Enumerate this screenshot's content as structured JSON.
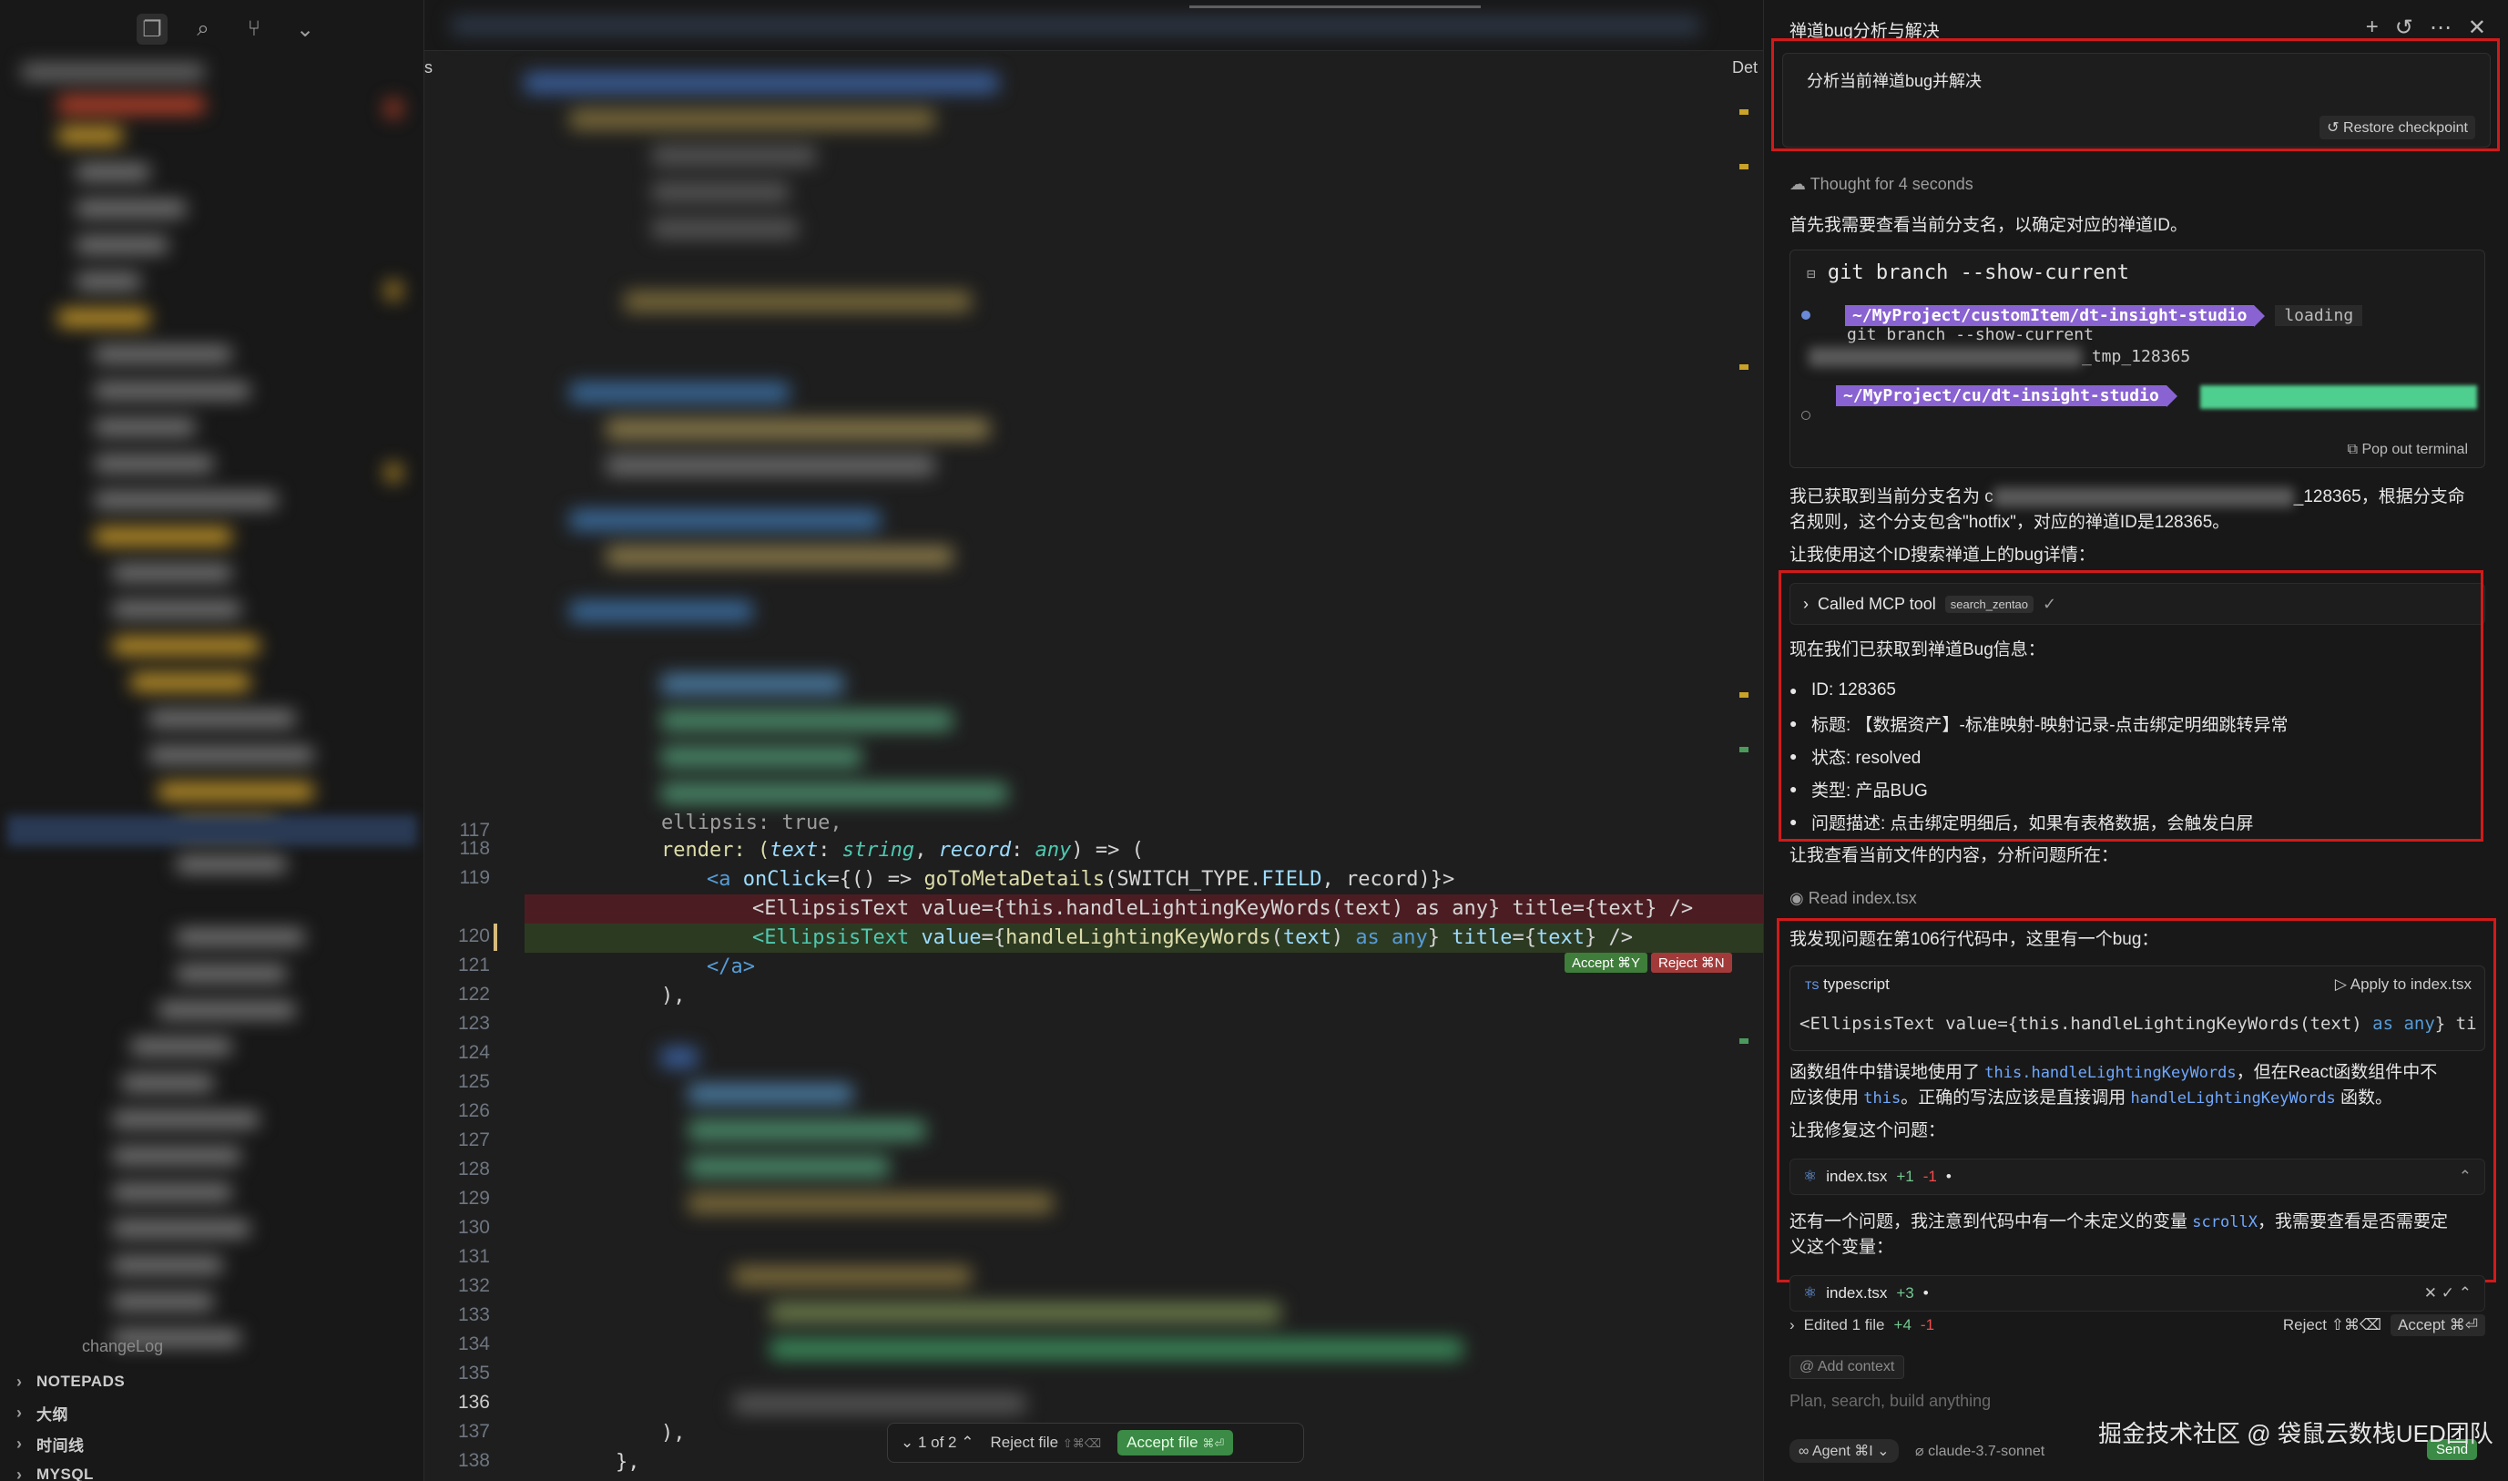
{
  "sidebar": {
    "bottom_panels": [
      "NOTEPADS",
      "大纲",
      "时间线",
      "MYSQL"
    ],
    "changelog": "changeLog"
  },
  "editor": {
    "tab_fragment": "s",
    "right_fragment": "Det",
    "line_numbers": [
      "117",
      "118",
      "119",
      "",
      "120",
      "121",
      "122",
      "123",
      "124",
      "125",
      "126",
      "127",
      "128",
      "129",
      "130",
      "131",
      "132",
      "133",
      "134",
      "135",
      "136",
      "137",
      "138"
    ],
    "current_line": "136",
    "code": {
      "l117": "ellipsis: true,",
      "l118_a": "render: (",
      "l118_b": "text",
      "l118_c": ": ",
      "l118_d": "string",
      "l118_e": ", ",
      "l118_f": "record",
      "l118_g": ": ",
      "l118_h": "any",
      "l118_i": ") => (",
      "l119_a": "<a ",
      "l119_b": "onClick",
      "l119_c": "={() => ",
      "l119_d": "goToMetaDetails",
      "l119_e": "(SWITCH_TYPE.",
      "l119_f": "FIELD",
      "l119_g": ", record)}>",
      "removed": "<EllipsisText value={this.handleLightingKeyWords(text) as any} title={text} />",
      "added_a": "<EllipsisText ",
      "added_b": "value",
      "added_c": "={",
      "added_d": "handleLightingKeyWords",
      "added_e": "(",
      "added_f": "text",
      "added_g": ") ",
      "added_h": "as any",
      "added_i": "} ",
      "added_j": "title",
      "added_k": "={",
      "added_l": "text",
      "added_m": "} />",
      "l121": "</a>",
      "l122": "),",
      "l137": "),",
      "l138": "},"
    },
    "inline_accept": "Accept ⌘Y",
    "inline_reject": "Reject ⌘N",
    "diff_bar": {
      "counter": "1 of 2",
      "reject_file": "Reject file",
      "reject_kbd": "⇧⌘⌫",
      "accept_file": "Accept file",
      "accept_kbd": "⌘⏎"
    }
  },
  "chat": {
    "title": "禅道bug分析与解决",
    "user_message": "分析当前禅道bug并解决",
    "restore_checkpoint": "Restore checkpoint",
    "thought": "Thought for 4 seconds",
    "p1": "首先我需要查看当前分支名，以确定对应的禅道ID。",
    "terminal": {
      "command_title": "git branch --show-current",
      "prompt1": "~/MyProject/customItem/dt-insight-studio",
      "loading": "loading",
      "cmd_echo": "git branch --show-current",
      "output_suffix": "_tmp_128365",
      "prompt2": "~/MyProject/cu/dt-insight-studio",
      "pop_out": "Pop out terminal"
    },
    "p2_a": "我已获取到当前分支名为 c",
    "p2_b": "_128365，根据分支命",
    "p2_c": "名规则，这个分支包含\"hotfix\"，对应的禅道ID是128365。",
    "p3": "让我使用这个ID搜索禅道上的bug详情：",
    "mcp": {
      "label": "Called MCP tool",
      "tool": "search_zentao",
      "check": "✓"
    },
    "bug_intro": "现在我们已获取到禅道Bug信息：",
    "bug_items": [
      "ID: 128365",
      "标题: 【数据资产】-标准映射-映射记录-点击绑定明细跳转异常",
      "状态: resolved",
      "类型: 产品BUG",
      "问题描述: 点击绑定明细后，如果有表格数据，会触发白屏"
    ],
    "p4": "让我查看当前文件的内容，分析问题所在：",
    "read_file": "Read index.tsx",
    "p5": "我发现问题在第106行代码中，这里有一个bug：",
    "code_card": {
      "lang": "typescript",
      "apply": "Apply to index.tsx",
      "code_a": "<EllipsisText value={this.handleLightingKeyWords(text) ",
      "code_b": "as any",
      "code_c": "} title"
    },
    "p6_a": "函数组件中错误地使用了 ",
    "p6_code1": "this.handleLightingKeyWords",
    "p6_b": "，但在React函数组件中不",
    "p6_c": "应该使用 ",
    "p6_code2": "this",
    "p6_d": "。正确的写法应该是直接调用 ",
    "p6_code3": "handleLightingKeyWords",
    "p6_e": " 函数。",
    "p7": "让我修复这个问题：",
    "file_row1": {
      "name": "index.tsx",
      "plus": "+1",
      "minus": "-1",
      "dot": "•"
    },
    "p8_a": "还有一个问题，我注意到代码中有一个未定义的变量 ",
    "p8_code": "scrollX",
    "p8_b": "，我需要查看是否需要定",
    "p8_c": "义这个变量：",
    "file_row2": {
      "name": "index.tsx",
      "plus": "+3",
      "dot": "•"
    },
    "edited": {
      "label": "Edited 1 file",
      "plus": "+4",
      "minus": "-1",
      "reject": "Reject ⇧⌘⌫",
      "accept": "Accept ⌘⏎"
    },
    "add_context": "Add context",
    "placeholder": "Plan, search, build anything",
    "agent": "Agent ⌘I",
    "model": "claude-3.7-sonnet",
    "send": "Send"
  },
  "watermark": "掘金技术社区 @ 袋鼠云数栈UED团队"
}
